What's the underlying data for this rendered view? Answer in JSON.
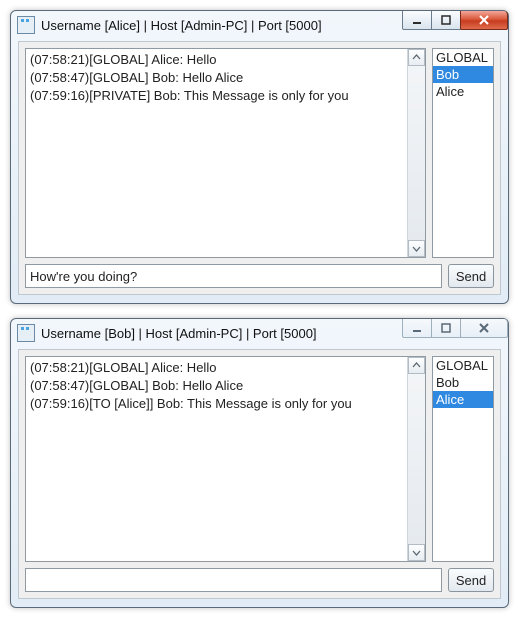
{
  "windows": [
    {
      "id": "alice",
      "title": "Username [Alice] | Host [Admin-PC] | Port [5000]",
      "messages": [
        "(07:58:21)[GLOBAL] Alice: Hello",
        "(07:58:47)[GLOBAL] Bob: Hello Alice",
        "(07:59:16)[PRIVATE] Bob: This Message is only for you"
      ],
      "users": {
        "items": [
          "GLOBAL",
          "Bob",
          "Alice"
        ],
        "selected_index": 1
      },
      "input_value": "How're you doing?",
      "send_label": "Send"
    },
    {
      "id": "bob",
      "title": "Username [Bob] | Host [Admin-PC] | Port [5000]",
      "messages": [
        "(07:58:21)[GLOBAL] Alice: Hello",
        "(07:58:47)[GLOBAL] Bob: Hello Alice",
        "(07:59:16)[TO [Alice]] Bob: This Message is only for you"
      ],
      "users": {
        "items": [
          "GLOBAL",
          "Bob",
          "Alice"
        ],
        "selected_index": 2
      },
      "input_value": "",
      "send_label": "Send"
    }
  ]
}
